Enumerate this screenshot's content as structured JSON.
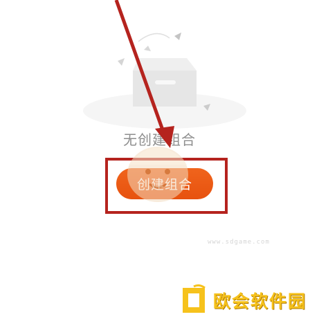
{
  "empty_state": {
    "message": "无创建组合",
    "illustration_icon": "empty-box-icon"
  },
  "actions": {
    "create_button_label": "创建组合"
  },
  "annotation": {
    "arrow_icon": "pointer-arrow-icon",
    "highlight_color": "#b5231e"
  },
  "watermark": {
    "site_name": "欧会软件园",
    "mascot_icon": "mascot-icon",
    "subtext": "www.sdgame.com"
  },
  "colors": {
    "accent": "#e95a14",
    "empty_text": "#8e8e8e"
  }
}
